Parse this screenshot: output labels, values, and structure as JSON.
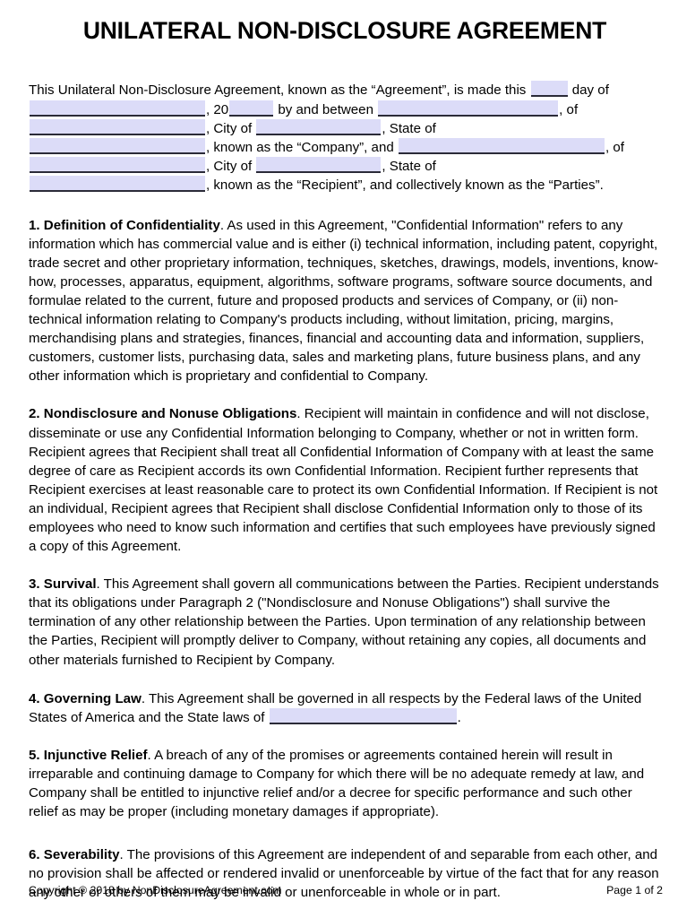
{
  "document": {
    "title": "UNILATERAL NON-DISCLOSURE AGREEMENT",
    "accent_fill_color": "#dcdcf8",
    "blank_underline_color": "#2b2b38",
    "page_background": "#ffffff",
    "text_color": "#000000"
  },
  "intro": {
    "t1": "This Unilateral Non-Disclosure Agreement, known as the “Agreement”, is made this",
    "t2": "day of",
    "t3": ", 20",
    "t4": "by and between",
    "t5": ", of",
    "t6": ", City of",
    "t7": ", State of",
    "t8": ", known as the “Company”, and",
    "t9": ", of",
    "t10": ", City of",
    "t11": ", State of",
    "t12": ", known as the “Recipient”, and collectively known as the “Parties”.",
    "fields": {
      "day": "",
      "month": "",
      "year": "",
      "company_name": "",
      "company_street": "",
      "company_city": "",
      "company_state": "",
      "recipient_name": "",
      "recipient_street": "",
      "recipient_city": "",
      "recipient_state": ""
    }
  },
  "sections": [
    {
      "number": "1.",
      "heading": "Definition of Confidentiality",
      "body": ". As used in this Agreement, \"Confidential Information\" refers to any information which has commercial value and is either (i) technical information, including patent, copyright, trade secret and other proprietary information, techniques, sketches, drawings, models, inventions, know-how, processes, apparatus, equipment, algorithms, software programs, software source documents, and formulae related to the current, future and proposed products and services of Company, or (ii) non-technical information relating to Company's products including, without limitation, pricing, margins, merchandising plans and strategies, finances, financial and accounting data and information, suppliers, customers, customer lists, purchasing data, sales and marketing plans, future business plans, and any other information which is proprietary and confidential to Company."
    },
    {
      "number": "2.",
      "heading": "Nondisclosure and Nonuse Obligations",
      "body": ". Recipient will maintain in confidence and will not disclose, disseminate or use any Confidential Information belonging to Company, whether or not in written form. Recipient agrees that Recipient shall treat all Confidential Information of Company with at least the same degree of care as Recipient accords its own Confidential Information. Recipient further represents that Recipient exercises at least reasonable care to protect its own Confidential Information. If Recipient is not an individual, Recipient agrees that Recipient shall disclose Confidential Information only to those of its employees who need to know such information and certifies that such employees have previously signed a copy of this Agreement."
    },
    {
      "number": "3.",
      "heading": "Survival",
      "body": ". This Agreement shall govern all communications between the Parties. Recipient understands that its obligations under Paragraph 2 (\"Nondisclosure and Nonuse Obligations\") shall survive the termination of any other relationship between the Parties. Upon termination of any relationship between the Parties, Recipient will promptly deliver to Company, without retaining any copies, all documents and other materials furnished to Recipient by Company."
    },
    {
      "number": "5.",
      "heading": "Injunctive Relief",
      "body": ".  A breach of any of the promises or agreements contained herein will result in irreparable and continuing damage to Company for which there will be no adequate remedy at law, and Company shall be entitled to injunctive relief and/or a decree for specific performance and such other relief as may be proper (including monetary damages if appropriate)."
    },
    {
      "number": "6.",
      "heading": "Severability",
      "body": ". The provisions of this Agreement are independent of and separable from each other, and no provision shall be affected or rendered invalid or unenforceable by virtue of the fact that for any reason any other or others of them may be invalid or unenforceable in whole or in part."
    }
  ],
  "governing_law": {
    "number": "4.",
    "heading": "Governing Law",
    "body_before": ".  This Agreement shall be governed in all respects by the Federal laws of the United States of America and the State laws of",
    "body_after": ".",
    "state_field": ""
  },
  "footer": {
    "copyright": "Copyright © 2018 by NonDisclosureAgreement.com",
    "page_label": "Page 1 of 2"
  }
}
